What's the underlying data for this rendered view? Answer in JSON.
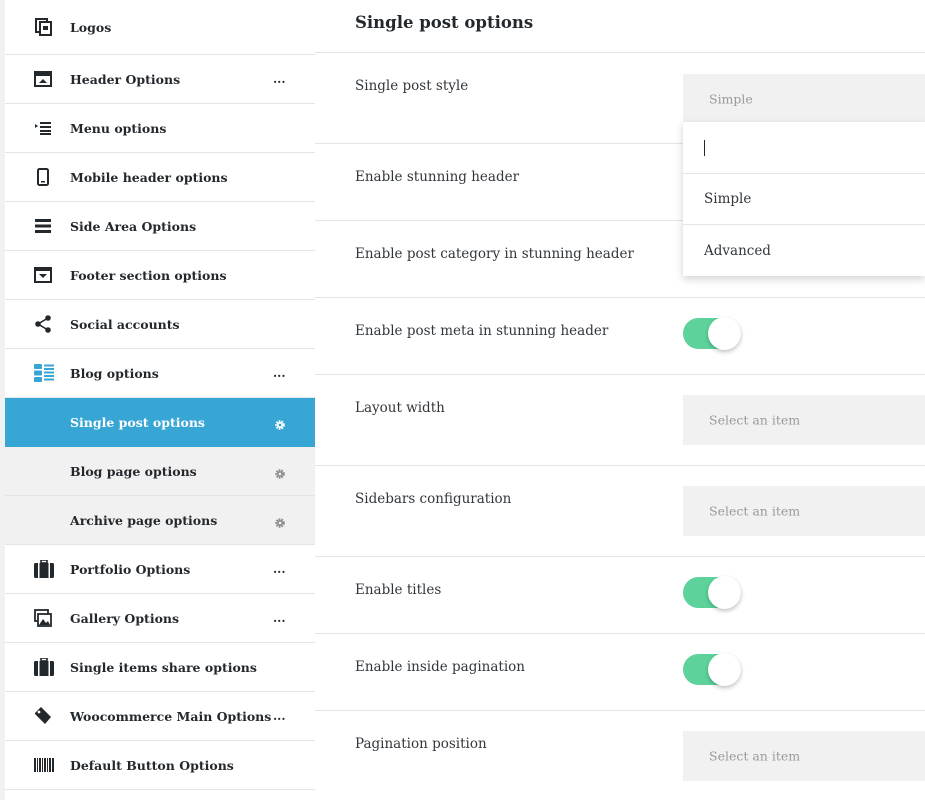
{
  "sidebar": {
    "items": [
      {
        "label": "Logos",
        "icon": "logos-icon",
        "more": false
      },
      {
        "label": "Header Options",
        "icon": "header-icon",
        "more": true
      },
      {
        "label": "Menu options",
        "icon": "menu-icon",
        "more": false
      },
      {
        "label": "Mobile header options",
        "icon": "mobile-icon",
        "more": false
      },
      {
        "label": "Side Area Options",
        "icon": "side-area-icon",
        "more": false
      },
      {
        "label": "Footer section options",
        "icon": "footer-icon",
        "more": false
      },
      {
        "label": "Social accounts",
        "icon": "share-icon",
        "more": false
      },
      {
        "label": "Blog options",
        "icon": "blog-icon",
        "more": true
      },
      {
        "label": "Single post options",
        "sub": true,
        "active": true
      },
      {
        "label": "Blog page options",
        "sub": true
      },
      {
        "label": "Archive page options",
        "sub": true
      },
      {
        "label": "Portfolio Options",
        "icon": "briefcase-icon",
        "more": true
      },
      {
        "label": "Gallery Options",
        "icon": "gallery-icon",
        "more": true
      },
      {
        "label": "Single items share options",
        "icon": "briefcase-icon",
        "more": false
      },
      {
        "label": "Woocommerce Main Options",
        "icon": "tag-icon",
        "more": true
      },
      {
        "label": "Default Button Options",
        "icon": "barcode-icon",
        "more": false
      }
    ],
    "more_symbol": "...",
    "colors": {
      "active": "#38a6d5",
      "toggle_on": "#5dd39b"
    }
  },
  "main": {
    "title": "Single post options",
    "rows": {
      "single_post_style": {
        "label": "Single post style",
        "value": "Simple"
      },
      "stunning_header": {
        "label": "Enable stunning header"
      },
      "post_category": {
        "label": "Enable post category in stunning header"
      },
      "post_meta": {
        "label": "Enable post meta in stunning header"
      },
      "layout_width": {
        "label": "Layout width",
        "placeholder": "Select an item"
      },
      "sidebars": {
        "label": "Sidebars configuration",
        "placeholder": "Select an item"
      },
      "titles": {
        "label": "Enable titles"
      },
      "inside_pagination": {
        "label": "Enable inside pagination"
      },
      "pagination_position": {
        "label": "Pagination position",
        "placeholder": "Select an item"
      }
    },
    "dropdown": {
      "options": [
        "Simple",
        "Advanced"
      ]
    }
  }
}
